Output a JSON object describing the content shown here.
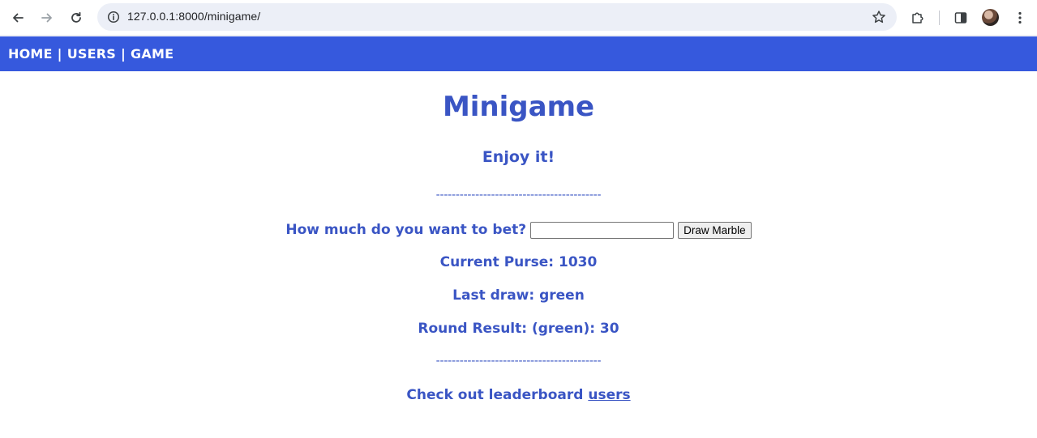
{
  "browser": {
    "url": "127.0.0.1:8000/minigame/"
  },
  "nav": {
    "home": "HOME",
    "users": "USERS",
    "game": "GAME",
    "separator": "|"
  },
  "page": {
    "title": "Minigame",
    "subtitle": "Enjoy it!",
    "divider": "------------------------------------------"
  },
  "bet": {
    "label": "How much do you want to bet?",
    "input_value": "",
    "button_label": "Draw Marble"
  },
  "stats": {
    "purse": "Current Purse: 1030",
    "last_draw": "Last draw: green",
    "round_result": "Round Result: (green): 30"
  },
  "leaderboard": {
    "text": "Check out leaderboard",
    "link": "users"
  },
  "colors": {
    "nav_bg": "#3659dd",
    "text_primary": "#3a55c4"
  }
}
